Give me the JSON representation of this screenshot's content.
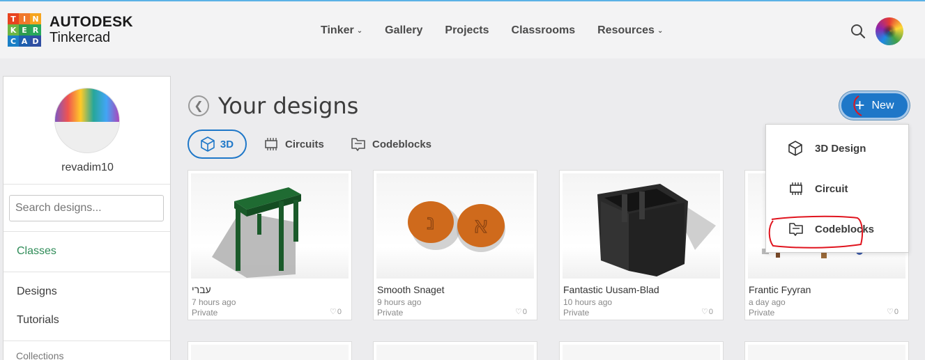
{
  "brand": {
    "logo_letters": [
      "T",
      "I",
      "N",
      "K",
      "E",
      "R",
      "C",
      "A",
      "D"
    ],
    "logo_colors": [
      "#e8431f",
      "#f0782b",
      "#f6a41e",
      "#6cb544",
      "#2d9d4e",
      "#28a85b",
      "#1a7fc6",
      "#1e5fae",
      "#2f4fa2"
    ],
    "company": "AUTODESK",
    "product": "Tinkercad"
  },
  "nav": [
    {
      "label": "Tinker",
      "has_menu": true
    },
    {
      "label": "Gallery",
      "has_menu": false
    },
    {
      "label": "Projects",
      "has_menu": false
    },
    {
      "label": "Classrooms",
      "has_menu": false
    },
    {
      "label": "Resources",
      "has_menu": true
    }
  ],
  "header_icons": {
    "search": "search-icon",
    "avatar": "user-avatar"
  },
  "sidebar": {
    "username": "revadim10",
    "search_placeholder": "Search designs...",
    "classes_label": "Classes",
    "designs_label": "Designs",
    "tutorials_label": "Tutorials",
    "collections_label": "Collections"
  },
  "main": {
    "title": "Your designs",
    "tabs": [
      {
        "label": "3D",
        "icon": "cube-icon",
        "active": true
      },
      {
        "label": "Circuits",
        "icon": "chip-icon",
        "active": false
      },
      {
        "label": "Codeblocks",
        "icon": "codeblocks-icon",
        "active": false
      }
    ],
    "new_button": "New"
  },
  "new_menu": [
    {
      "label": "3D Design",
      "icon": "cube-icon"
    },
    {
      "label": "Circuit",
      "icon": "chip-icon"
    },
    {
      "label": "Codeblocks",
      "icon": "codeblocks-icon"
    }
  ],
  "designs": [
    {
      "name": "עברי",
      "time": "7 hours ago",
      "visibility": "Private",
      "likes": "0"
    },
    {
      "name": "Smooth Snaget",
      "time": "9 hours ago",
      "visibility": "Private",
      "likes": "0"
    },
    {
      "name": "Fantastic Uusam-Blad",
      "time": "10 hours ago",
      "visibility": "Private",
      "likes": "0"
    },
    {
      "name": "Frantic Fyyran",
      "time": "a day ago",
      "visibility": "Private",
      "likes": "0"
    }
  ],
  "coins": {
    "left_letter": "נ",
    "right_letter": "א"
  },
  "colors": {
    "accent": "#1e77c8",
    "link_green": "#2e8b57",
    "annotation_red": "#e0141e"
  }
}
